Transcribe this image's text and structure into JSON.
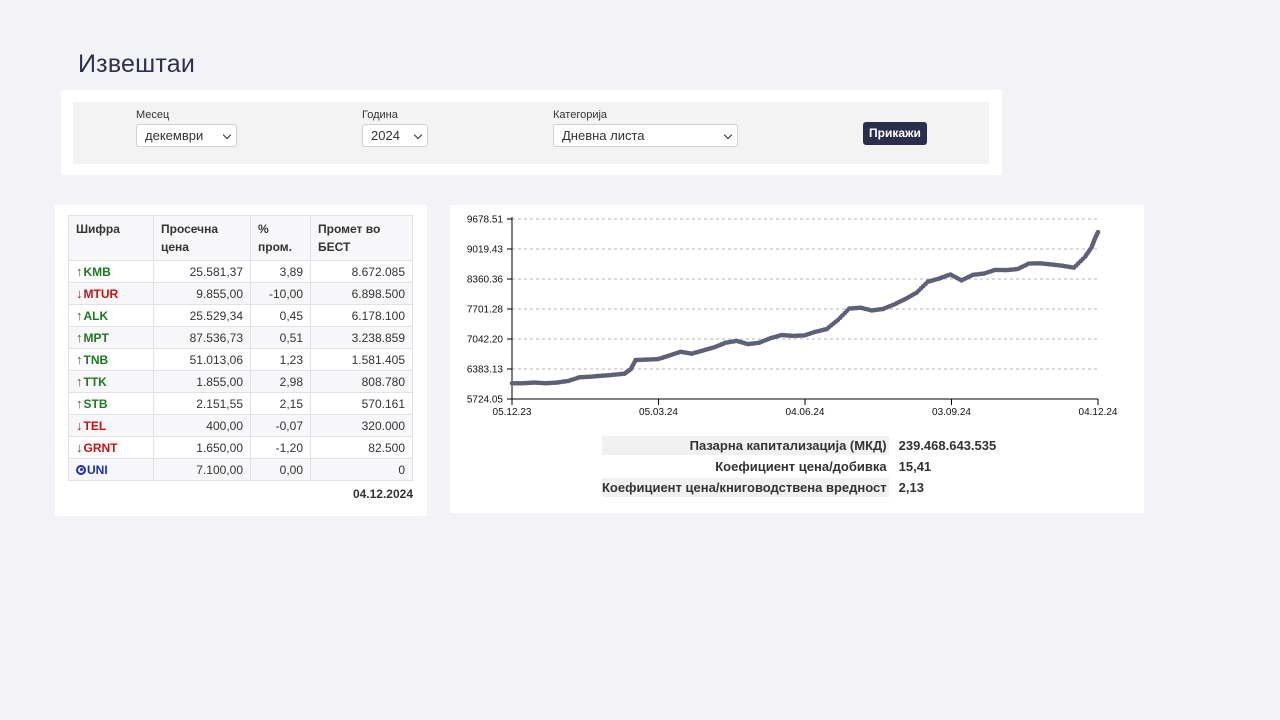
{
  "page": {
    "title": "Извештаи"
  },
  "filters": {
    "month": {
      "label": "Месец",
      "value": "декември"
    },
    "year": {
      "label": "Година",
      "value": "2024"
    },
    "category": {
      "label": "Категорија",
      "value": "Дневна листа"
    },
    "submit_label": "Прикажи"
  },
  "table": {
    "headers": {
      "symbol": "Шифра",
      "avg_price": "Просечна цена",
      "pct_change": "% пром.",
      "turnover": "Промет во БЕСТ"
    },
    "rows": [
      {
        "symbol": "KMB",
        "trend": "up",
        "avg_price": "25.581,37",
        "pct_change": "3,89",
        "turnover": "8.672.085"
      },
      {
        "symbol": "MTUR",
        "trend": "down",
        "avg_price": "9.855,00",
        "pct_change": "-10,00",
        "turnover": "6.898.500"
      },
      {
        "symbol": "ALK",
        "trend": "up",
        "avg_price": "25.529,34",
        "pct_change": "0,45",
        "turnover": "6.178.100"
      },
      {
        "symbol": "MPT",
        "trend": "up",
        "avg_price": "87.536,73",
        "pct_change": "0,51",
        "turnover": "3.238.859"
      },
      {
        "symbol": "TNB",
        "trend": "up",
        "avg_price": "51.013,06",
        "pct_change": "1,23",
        "turnover": "1.581.405"
      },
      {
        "symbol": "TTK",
        "trend": "up",
        "avg_price": "1.855,00",
        "pct_change": "2,98",
        "turnover": "808.780"
      },
      {
        "symbol": "STB",
        "trend": "up",
        "avg_price": "2.151,55",
        "pct_change": "2,15",
        "turnover": "570.161"
      },
      {
        "symbol": "TEL",
        "trend": "down",
        "avg_price": "400,00",
        "pct_change": "-0,07",
        "turnover": "320.000"
      },
      {
        "symbol": "GRNT",
        "trend": "down",
        "avg_price": "1.650,00",
        "pct_change": "-1,20",
        "turnover": "82.500"
      },
      {
        "symbol": "UNI",
        "trend": "flat",
        "avg_price": "7.100,00",
        "pct_change": "0,00",
        "turnover": "0"
      }
    ],
    "date": "04.12.2024"
  },
  "colors": {
    "up": "#1e7a1e",
    "down": "#cc1111",
    "flat": "#1a2fb3",
    "series": "#5e6078",
    "accent": "#2b2d4d"
  },
  "icons": {
    "up": "arrow-up-icon",
    "down": "arrow-down-icon",
    "flat": "circle-dot-icon"
  },
  "chart_data": {
    "type": "line",
    "title": "",
    "xlabel": "",
    "ylabel": "",
    "grid": true,
    "ylim": [
      5724.05,
      9678.51
    ],
    "y_ticks": [
      "5724.05",
      "6383.13",
      "7042.20",
      "7701.28",
      "8360.36",
      "9019.43",
      "9678.51"
    ],
    "x_ticks": [
      "05.12.23",
      "05.03.24",
      "04.06.24",
      "03.09.24",
      "04.12.24"
    ],
    "xlim": [
      "2023-12-05",
      "2024-12-04"
    ],
    "series": [
      {
        "name": "",
        "points": [
          [
            "2023-12-05",
            6070
          ],
          [
            "2023-12-12",
            6070
          ],
          [
            "2023-12-19",
            6085
          ],
          [
            "2023-12-26",
            6070
          ],
          [
            "2024-01-02",
            6085
          ],
          [
            "2024-01-09",
            6120
          ],
          [
            "2024-01-16",
            6200
          ],
          [
            "2024-01-23",
            6215
          ],
          [
            "2024-01-30",
            6235
          ],
          [
            "2024-02-06",
            6255
          ],
          [
            "2024-02-13",
            6280
          ],
          [
            "2024-02-17",
            6380
          ],
          [
            "2024-02-20",
            6580
          ],
          [
            "2024-02-27",
            6590
          ],
          [
            "2024-03-05",
            6600
          ],
          [
            "2024-03-12",
            6680
          ],
          [
            "2024-03-19",
            6760
          ],
          [
            "2024-03-26",
            6720
          ],
          [
            "2024-04-02",
            6790
          ],
          [
            "2024-04-09",
            6860
          ],
          [
            "2024-04-16",
            6960
          ],
          [
            "2024-04-23",
            7000
          ],
          [
            "2024-04-30",
            6930
          ],
          [
            "2024-05-07",
            6960
          ],
          [
            "2024-05-14",
            7060
          ],
          [
            "2024-05-21",
            7130
          ],
          [
            "2024-05-28",
            7110
          ],
          [
            "2024-06-04",
            7120
          ],
          [
            "2024-06-11",
            7200
          ],
          [
            "2024-06-18",
            7260
          ],
          [
            "2024-06-25",
            7460
          ],
          [
            "2024-07-02",
            7710
          ],
          [
            "2024-07-09",
            7730
          ],
          [
            "2024-07-16",
            7670
          ],
          [
            "2024-07-23",
            7700
          ],
          [
            "2024-07-30",
            7800
          ],
          [
            "2024-08-06",
            7920
          ],
          [
            "2024-08-13",
            8060
          ],
          [
            "2024-08-20",
            8300
          ],
          [
            "2024-08-27",
            8370
          ],
          [
            "2024-09-03",
            8460
          ],
          [
            "2024-09-10",
            8330
          ],
          [
            "2024-09-17",
            8450
          ],
          [
            "2024-09-24",
            8480
          ],
          [
            "2024-10-01",
            8560
          ],
          [
            "2024-10-08",
            8555
          ],
          [
            "2024-10-15",
            8580
          ],
          [
            "2024-10-22",
            8700
          ],
          [
            "2024-10-29",
            8705
          ],
          [
            "2024-11-05",
            8680
          ],
          [
            "2024-11-12",
            8650
          ],
          [
            "2024-11-19",
            8610
          ],
          [
            "2024-11-26",
            8850
          ],
          [
            "2024-11-30",
            9060
          ],
          [
            "2024-12-02",
            9240
          ],
          [
            "2024-12-04",
            9390
          ]
        ]
      }
    ]
  },
  "stats": [
    {
      "label": "Пазарна капитализација (МКД)",
      "value": "239.468.643.535"
    },
    {
      "label": "Коефициент цена/добивка",
      "value": "15,41"
    },
    {
      "label": "Коефициент цена/книговодствена вредност",
      "value": "2,13"
    }
  ]
}
